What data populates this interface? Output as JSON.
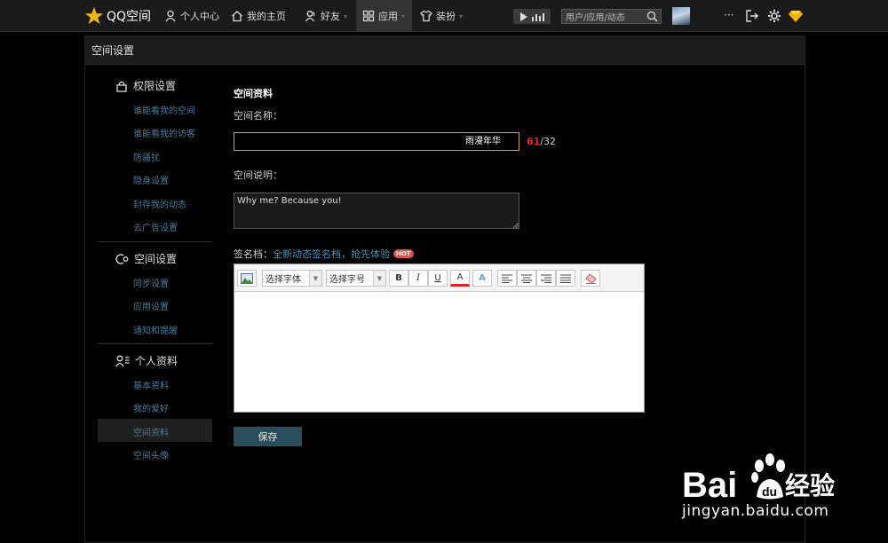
{
  "topbar": {
    "logo_text": "QQ空间",
    "nav": [
      {
        "label": "个人中心",
        "icon": "user-icon"
      },
      {
        "label": "我的主页",
        "icon": "home-icon"
      },
      {
        "label": "好友",
        "icon": "friends-icon"
      },
      {
        "label": "应用",
        "icon": "apps-grid-icon"
      },
      {
        "label": "装扮",
        "icon": "shirt-icon"
      }
    ],
    "search_placeholder": "用户/应用/动态",
    "more_label": "···"
  },
  "panel": {
    "title": "空间设置"
  },
  "sidebar": {
    "sections": [
      {
        "title": "权限设置",
        "icon": "lock-icon",
        "items": [
          "谁能看我的空间",
          "谁能看我的访客",
          "防骚扰",
          "隐身设置",
          "封存我的动态",
          "去广告设置"
        ]
      },
      {
        "title": "空间设置",
        "icon": "space-settings-icon",
        "items": [
          "同步设置",
          "应用设置",
          "通知和提醒"
        ]
      },
      {
        "title": "个人资料",
        "icon": "profile-icon",
        "items": [
          "基本资料",
          "我的爱好",
          "空间资料",
          "空间头像"
        ]
      }
    ],
    "active_item": "空间资料"
  },
  "main": {
    "section_title": "空间资料",
    "name_label": "空间名称：",
    "name_value": "雨漫年华",
    "counter_used": "61",
    "counter_max": "/32",
    "desc_label": "空间说明：",
    "desc_value": "Why me? Because you!",
    "sig_label": "签名档：",
    "sig_link": "全新动态签名档，抢先体验",
    "hot_badge": "HOT",
    "editor": {
      "font_select": "选择字体",
      "size_select": "选择字号",
      "bold": "B",
      "italic": "I",
      "underline": "U",
      "font_color": "A",
      "highlight": "A"
    },
    "save_label": "保存"
  },
  "watermark": {
    "brand": "Bai",
    "brand_cn": "经验",
    "url": "jingyan.baidu.com"
  },
  "colors": {
    "accent_border": "#c9a94a",
    "link": "#4c7a98",
    "save_button": "#2a4d5c",
    "counter_over": "#e22"
  }
}
